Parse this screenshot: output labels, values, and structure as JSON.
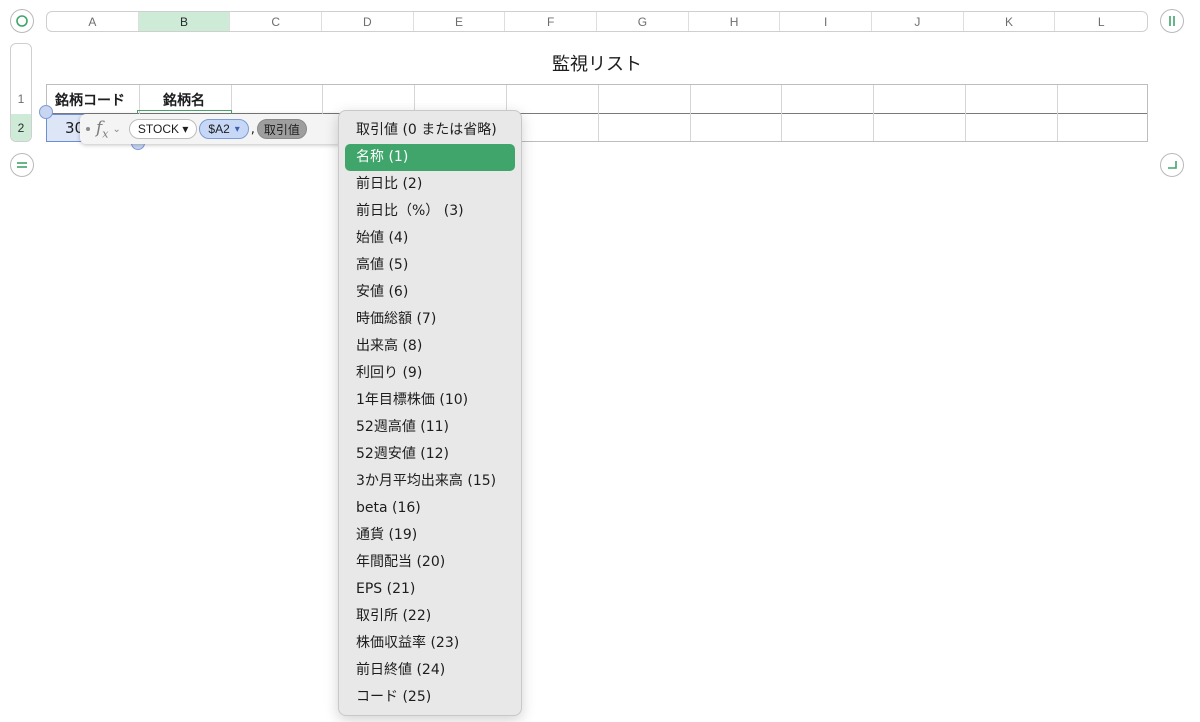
{
  "sheet": {
    "title": "監視リスト",
    "columns": [
      "A",
      "B",
      "C",
      "D",
      "E",
      "F",
      "G",
      "H",
      "I",
      "J",
      "K",
      "L"
    ],
    "selected_column": "B",
    "rows": [
      "1",
      "2"
    ],
    "selected_row": "2",
    "header_row": [
      "銘柄コード",
      "銘柄名"
    ],
    "a2_value_visible": "30"
  },
  "formula": {
    "fx_label": "fx",
    "function_token": "STOCK ▾",
    "ref_token": "$A2",
    "ref_chevron": "▾",
    "separator": ",",
    "arg_token": "取引值"
  },
  "dropdown": {
    "selected_index": 1,
    "items": [
      "取引値 (0 または省略)",
      "名称 (1)",
      "前日比 (2)",
      "前日比（%） (3)",
      "始値 (4)",
      "高値 (5)",
      "安値 (6)",
      "時価総額 (7)",
      "出来高 (8)",
      "利回り (9)",
      "1年目標株価 (10)",
      "52週高値 (11)",
      "52週安値 (12)",
      "3か月平均出来高 (15)",
      "beta (16)",
      "通貨 (19)",
      "年間配当 (20)",
      "EPS (21)",
      "取引所 (22)",
      "株価収益率 (23)",
      "前日終値 (24)",
      "コード (25)"
    ]
  },
  "colors": {
    "accent_green": "#3fa56a",
    "selection_blue": "#c6d8f6",
    "header_selected": "#cdebd7"
  }
}
